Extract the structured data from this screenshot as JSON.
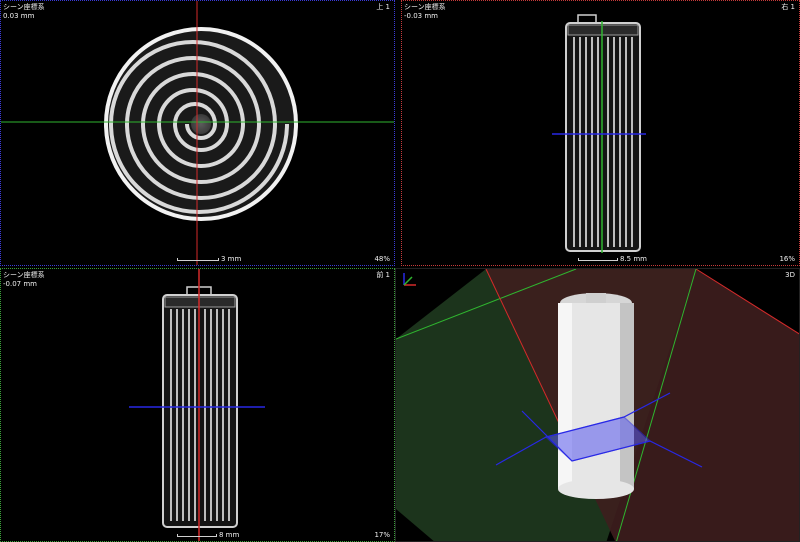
{
  "viewports": {
    "top": {
      "title": "シーン座標系",
      "depth": "0.03 mm",
      "orientation": "上 1",
      "scale": "3 mm",
      "zoom": "48%"
    },
    "right": {
      "title": "シーン座標系",
      "depth": "-0.03 mm",
      "orientation": "右 1",
      "scale": "8.5 mm",
      "zoom": "16%"
    },
    "front": {
      "title": "シーン座標系",
      "depth": "-0.07 mm",
      "orientation": "前 1",
      "scale": "8 mm",
      "zoom": "17%"
    },
    "three_d": {
      "orientation": "3D"
    }
  },
  "colors": {
    "axis_x": "#d42a2a",
    "axis_y": "#2fb52f",
    "axis_z": "#2828e6",
    "border_top": "#3a3ad6",
    "border_right": "#c83a3a",
    "border_front": "#3aa23a"
  },
  "icons": {
    "axes_gizmo": "xyz-axes-icon"
  }
}
